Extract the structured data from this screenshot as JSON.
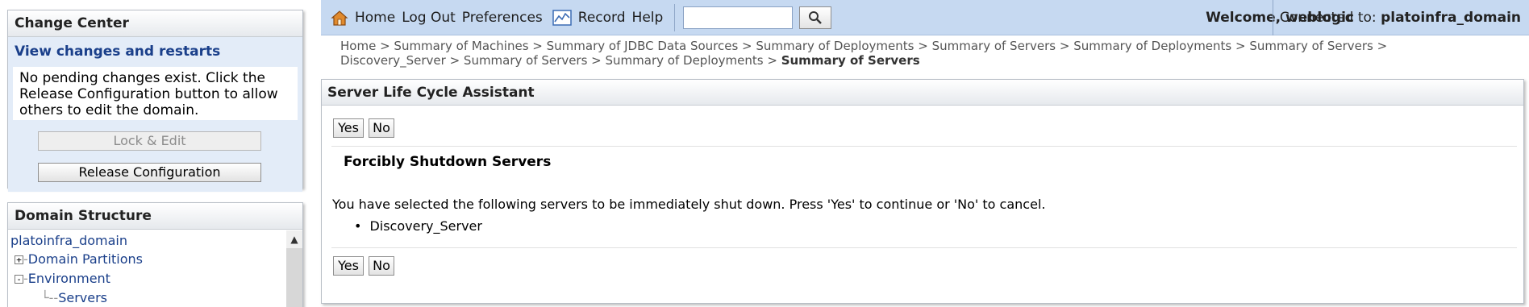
{
  "change_center": {
    "title": "Change Center",
    "subtitle": "View changes and restarts",
    "message": "No pending changes exist. Click the Release Configuration button to allow others to edit the domain.",
    "lock_edit_label": "Lock & Edit",
    "release_config_label": "Release Configuration"
  },
  "domain_structure": {
    "title": "Domain Structure",
    "root": "platoinfra_domain",
    "items": [
      {
        "label": "Domain Partitions",
        "expander": "+"
      },
      {
        "label": "Environment",
        "expander": "-"
      },
      {
        "label": "Servers",
        "expander": ""
      }
    ]
  },
  "toolbar": {
    "home": "Home",
    "logout": "Log Out",
    "preferences": "Preferences",
    "record": "Record",
    "help": "Help",
    "search_value": "",
    "welcome": "Welcome, weblogic",
    "connected_label": "Connected to:",
    "domain": "platoinfra_domain"
  },
  "breadcrumb": {
    "items": [
      "Home >",
      "Summary of Machines >",
      "Summary of JDBC Data Sources >",
      "Summary of Deployments >",
      "Summary of Servers >",
      "Summary of Deployments >",
      "Summary of Servers >",
      "Discovery_Server >",
      "Summary of Servers >",
      "Summary of Deployments >"
    ],
    "current": "Summary of Servers"
  },
  "assistant": {
    "title": "Server Life Cycle Assistant",
    "yes_label": "Yes",
    "no_label": "No",
    "section_title": "Forcibly Shutdown Servers",
    "message": "You have selected the following servers to be immediately shut down. Press 'Yes' to continue or 'No' to cancel.",
    "servers": [
      "Discovery_Server"
    ]
  },
  "colors": {
    "toolbar_bg": "#c6d9f1",
    "link": "#1a3f8a",
    "change_center_bg": "#e3ecf8"
  }
}
